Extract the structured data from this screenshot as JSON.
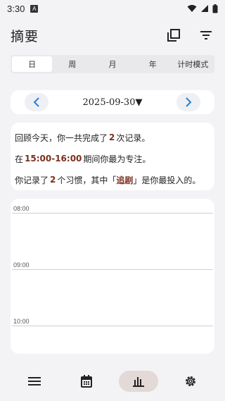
{
  "status_bar": {
    "time": "3:30",
    "notification_letter": "A"
  },
  "header": {
    "title": "摘要"
  },
  "tabs": [
    {
      "label": "日",
      "active": true
    },
    {
      "label": "周",
      "active": false
    },
    {
      "label": "月",
      "active": false
    },
    {
      "label": "年",
      "active": false
    },
    {
      "label": "计时模式",
      "active": false
    }
  ],
  "date_nav": {
    "date": "2025-09-30▼"
  },
  "summary": {
    "line1_a": "回顾今天，你一共完成了",
    "line1_value": "2",
    "line1_b": "次记录。",
    "line2_a": "在",
    "line2_value": "15:00-16:00",
    "line2_b": "期间你最为专注。",
    "line3_a": "你记录了",
    "line3_value": "2",
    "line3_b": "个习惯，其中「",
    "line3_habit": "追剧",
    "line3_c": "」是你最投入的。"
  },
  "timeline": {
    "hours": [
      "08:00",
      "09:00",
      "10:00"
    ]
  },
  "colors": {
    "accent": "#7a2e1d",
    "nav_blue": "#2a7fd4",
    "active_nav_bg": "#e3d9d6"
  },
  "icons": {
    "status": [
      "wifi-icon",
      "signal-icon",
      "battery-icon"
    ],
    "header": [
      "copy-icon",
      "filter-icon"
    ],
    "bottom_nav": [
      "list-icon",
      "calendar-icon",
      "chart-icon",
      "gear-icon"
    ]
  }
}
